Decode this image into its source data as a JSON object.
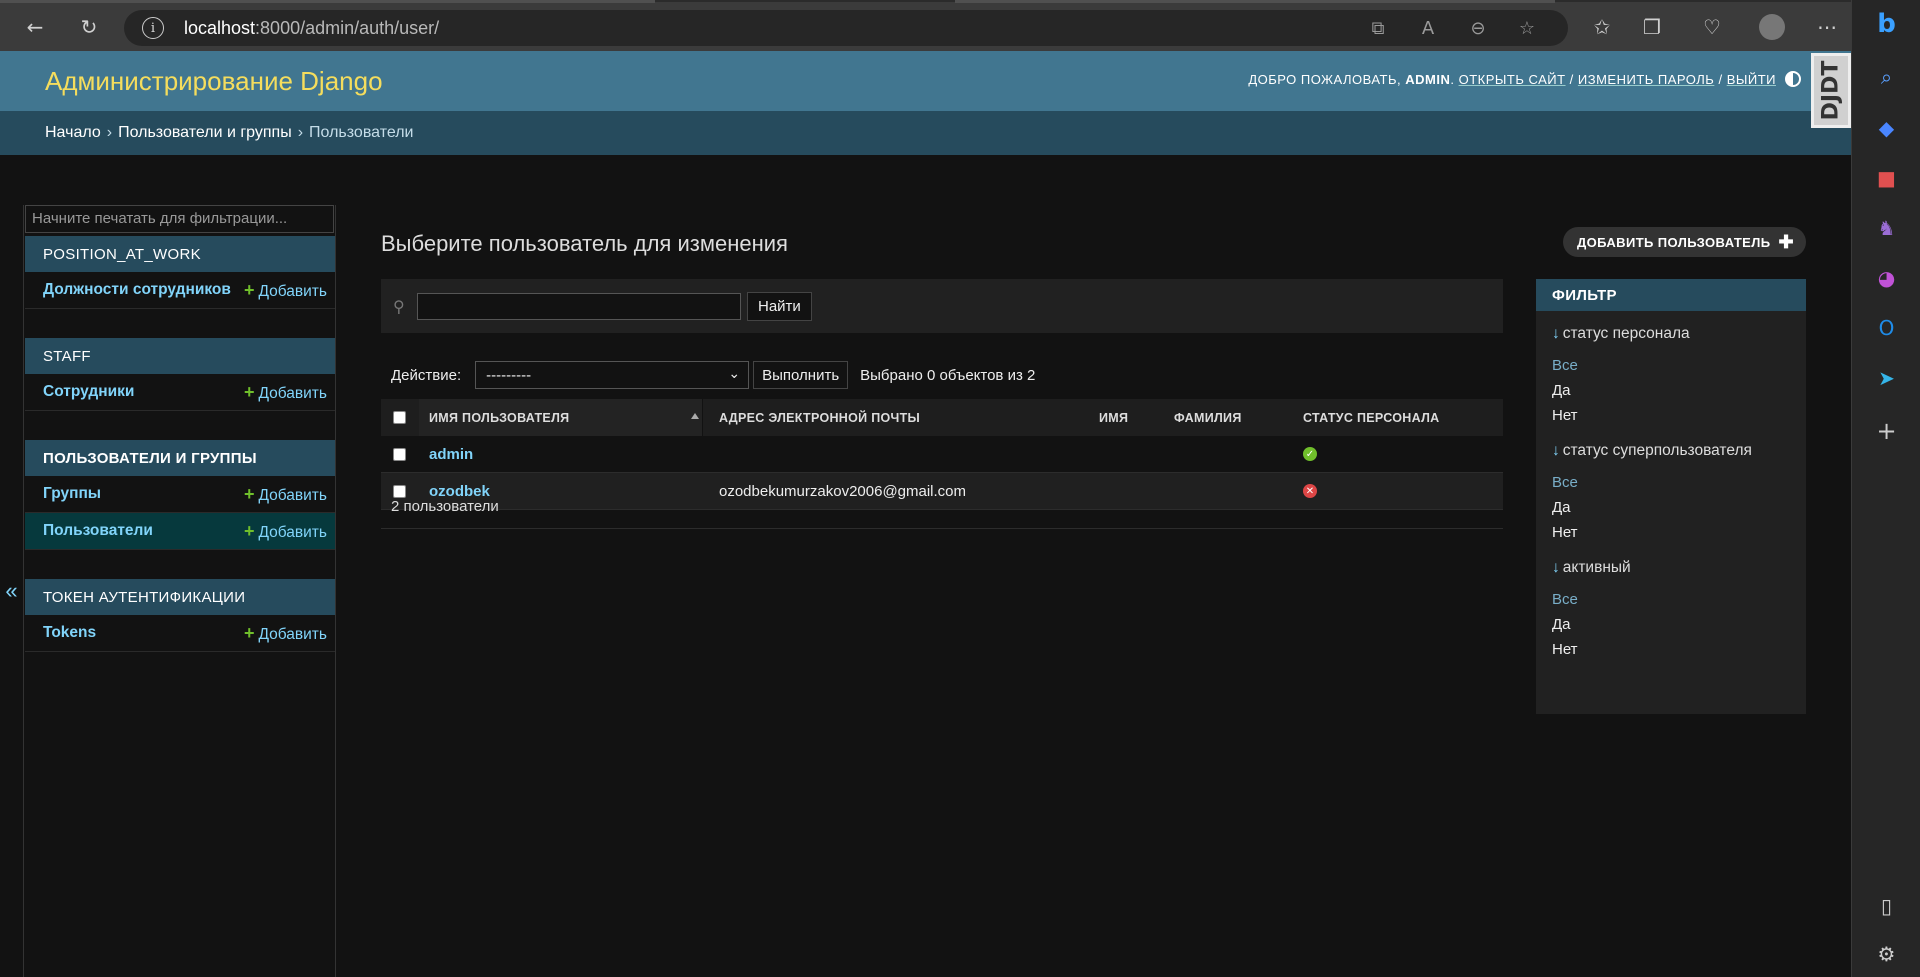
{
  "browser": {
    "url_host": "localhost",
    "url_path": ":8000/admin/auth/user/"
  },
  "header": {
    "site_name": "Администрирование Django",
    "welcome": "ДОБРО ПОЖАЛОВАТЬ,",
    "username": "ADMIN",
    "view_site": "ОТКРЫТЬ САЙТ",
    "change_password": "ИЗМЕНИТЬ ПАРОЛЬ",
    "logout": "ВЫЙТИ",
    "djdt": "DJDT"
  },
  "breadcrumbs": [
    "Начало",
    "Пользователи и группы",
    "Пользователи"
  ],
  "sidebar": {
    "filter_placeholder": "Начните печатать для фильтрации...",
    "collapse": "«",
    "modules": [
      {
        "caption": "POSITION_AT_WORK",
        "rows": [
          {
            "name": "Должности сотрудников",
            "add": "Добавить"
          }
        ]
      },
      {
        "caption": "STAFF",
        "rows": [
          {
            "name": "Сотрудники",
            "add": "Добавить"
          }
        ]
      },
      {
        "caption": "ПОЛЬЗОВАТЕЛИ И ГРУППЫ",
        "rows": [
          {
            "name": "Группы",
            "add": "Добавить"
          },
          {
            "name": "Пользователи",
            "add": "Добавить"
          }
        ]
      },
      {
        "caption": "ТОКЕН АУТЕНТИФИКАЦИИ",
        "rows": [
          {
            "name": "Tokens",
            "add": "Добавить"
          }
        ]
      }
    ]
  },
  "content": {
    "title": "Выберите пользователь для изменения",
    "add_button": "ДОБАВИТЬ ПОЛЬЗОВАТЕЛЬ",
    "search_button": "Найти",
    "action_label": "Действие:",
    "action_value": "---------",
    "action_go": "Выполнить",
    "action_counter": "Выбрано 0 объектов из 2",
    "columns": [
      "ИМЯ ПОЛЬЗОВАТЕЛЯ",
      "АДРЕС ЭЛЕКТРОННОЙ ПОЧТЫ",
      "ИМЯ",
      "ФАМИЛИЯ",
      "СТАТУС ПЕРСОНАЛА"
    ],
    "rows": [
      {
        "username": "admin",
        "email": "",
        "first_name": "",
        "last_name": "",
        "is_staff": true
      },
      {
        "username": "ozodbek",
        "email": "ozodbekumurzakov2006@gmail.com",
        "first_name": "",
        "last_name": "",
        "is_staff": false
      }
    ],
    "paginator": "2 пользователи"
  },
  "filter": {
    "title": "ФИЛЬТР",
    "groups": [
      {
        "title": "статус персонала",
        "options": [
          "Все",
          "Да",
          "Нет"
        ]
      },
      {
        "title": "статус суперпользователя",
        "options": [
          "Все",
          "Да",
          "Нет"
        ]
      },
      {
        "title": "активный",
        "options": [
          "Все",
          "Да",
          "Нет"
        ]
      }
    ]
  },
  "colors": {
    "header_bg": "#417690",
    "breadcrumbs_bg": "#264b5d",
    "site_name": "#f5dd5d",
    "link": "#81d4fa",
    "add_plus": "#70bf2b",
    "boolean_no": "#dd4646"
  }
}
